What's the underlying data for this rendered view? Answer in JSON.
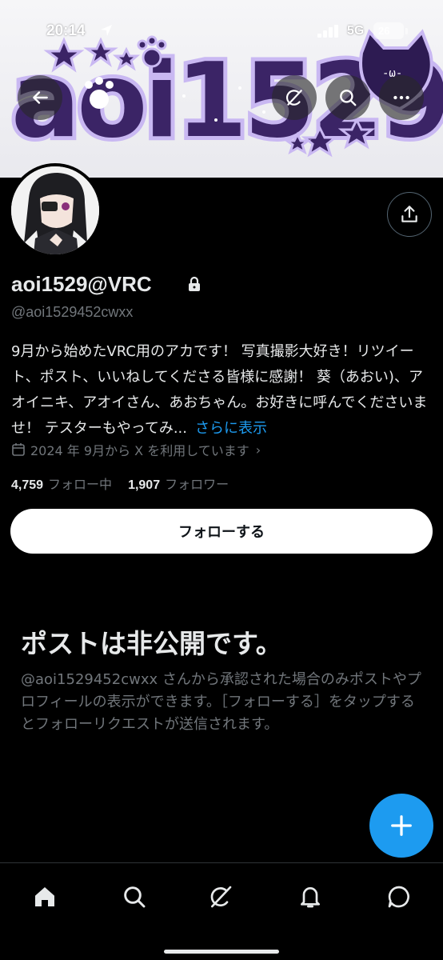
{
  "status_bar": {
    "time": "20:14",
    "network": "5G",
    "battery": "26"
  },
  "banner": {
    "logo_text": "aoi1529"
  },
  "profile": {
    "display_name": "aoi1529@VRC",
    "handle": "@aoi1529452cwxx",
    "bio": "9月から始めたVRC用のアカです！ 写真撮影大好き！リツイート、ポスト、いいねしてくださる皆様に感謝！ 葵（あおい)、アオイニキ、アオイさん、あおちゃん。お好きに呼んでくださいませ！ テスターもやってみ...",
    "bio_more": "さらに表示",
    "joined": "2024 年 9月から X を利用しています",
    "following_count": "4,759",
    "following_label": "フォロー中",
    "followers_count": "1,907",
    "followers_label": "フォロワー",
    "follow_button": "フォローする"
  },
  "private": {
    "title": "ポストは非公開です。",
    "description": "@aoi1529452cwxx さんから承認された場合のみポストやプロフィールの表示ができます。［フォローする］をタップするとフォローリクエストが送信されます。"
  },
  "icons": {
    "back": "arrow-left-icon",
    "grok": "grok-icon",
    "search": "search-icon",
    "more": "more-icon",
    "share": "share-icon",
    "lock": "lock-icon",
    "calendar": "calendar-icon",
    "compose": "plus-icon",
    "home": "home-icon",
    "notifications": "bell-icon",
    "messages": "message-icon"
  },
  "colors": {
    "accent": "#1d9bf0",
    "background": "#000000",
    "secondary_text": "#71767b",
    "banner_purple": "#3b2466"
  }
}
